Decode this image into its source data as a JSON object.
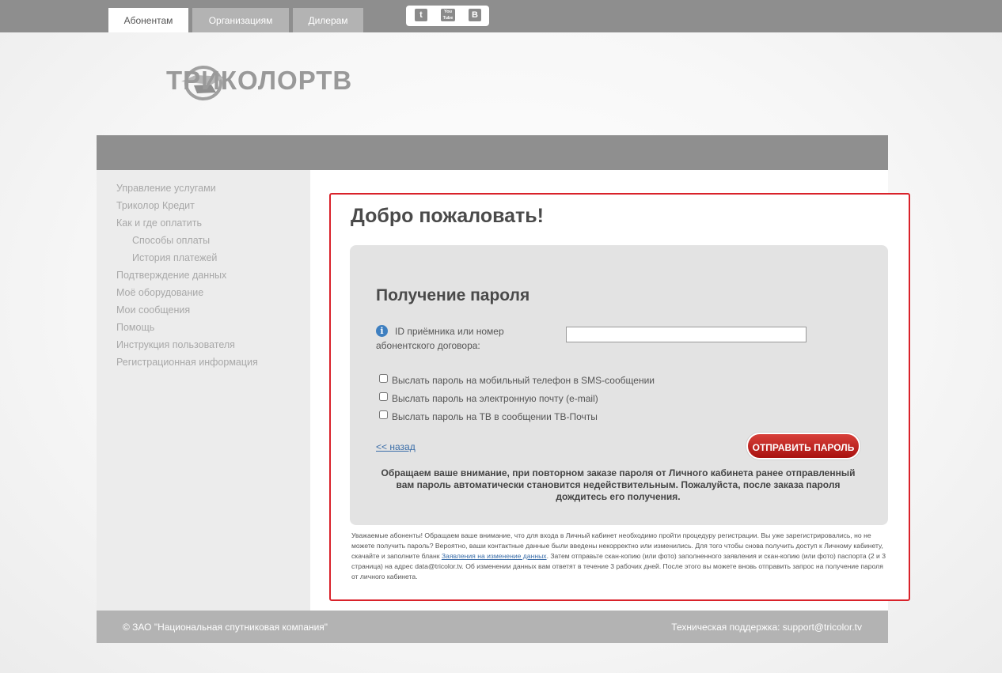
{
  "tabs": [
    "Абонентам",
    "Организациям",
    "Дилерам"
  ],
  "social": {
    "twitter": "t",
    "youtube": "You Tube",
    "vk": "B"
  },
  "logo": {
    "text": "ТРИКОЛОРТВ"
  },
  "sidebar": {
    "items": [
      "Управление услугами",
      "Триколор Кредит",
      "Как и где оплатить",
      "Способы оплаты",
      "История платежей",
      "Подтверждение данных",
      "Моё оборудование",
      "Мои сообщения",
      "Помощь",
      "Инструкция пользователя",
      "Регистрационная информация"
    ]
  },
  "main": {
    "welcome": "Добро пожаловать!",
    "panel_title": "Получение пароля",
    "id_label_line1": "ID приёмника или номер",
    "id_label_line2": "абонентского договора:",
    "id_value": "",
    "options": [
      "Выслать пароль на мобильный телефон в SMS-сообщении",
      "Выслать пароль на электронную почту (e-mail)",
      "Выслать пароль на ТВ в сообщении ТВ-Почты"
    ],
    "back": "<< назад",
    "send": "ОТПРАВИТЬ ПАРОЛЬ",
    "notice": "Обращаем ваше внимание, при повторном заказе пароля от Личного кабинета ранее отправленный вам пароль автоматически становится недействительным. Пожалуйста, после заказа пароля дождитесь его получения.",
    "note_before": "Уважаемые абоненты! Обращаем ваше внимание, что для входа в Личный кабинет необходимо пройти процедуру регистрации. Вы уже зарегистрировались, но не можете получить пароль? Вероятно, ваши контактные данные были введены некорректно или изменились. Для того чтобы снова получить доступ к Личному кабинету, скачайте и заполните бланк ",
    "note_link": "Заявления на изменение данных",
    "note_after": ". Затем отправьте скан-копию (или фото) заполненного заявления и скан-копию (или фото) паспорта (2 и 3 страница) на адрес data@tricolor.tv. Об изменении данных вам ответят в течение 3 рабочих дней. После этого вы можете вновь отправить запрос на получение пароля от личного кабинета."
  },
  "footer": {
    "left": "© ЗАО \"Национальная спутниковая компания\"",
    "right": "Техническая поддержка: support@tricolor.tv"
  },
  "colors": {
    "accent_red": "#d9222a",
    "button_red": "#b8201b",
    "link_blue": "#3a6da8"
  }
}
